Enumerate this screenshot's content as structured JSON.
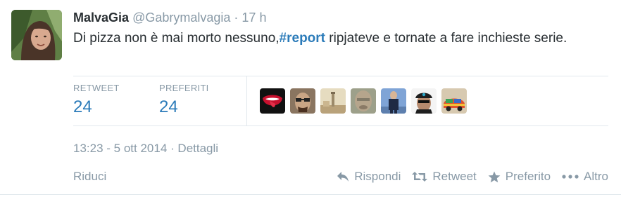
{
  "tweet": {
    "fullname": "MalvaGia",
    "username": "@Gabrymalvagia",
    "separator": "·",
    "time": "17 h",
    "text_before": "Di pizza non è mai morto nessuno,",
    "hashtag": "#report",
    "text_after": " ripjateve e tornate a fare inchieste serie."
  },
  "stats": [
    {
      "label": "RETWEET",
      "value": "24"
    },
    {
      "label": "PREFERITI",
      "value": "24"
    }
  ],
  "favoriters": [
    {
      "name": "rolling-stones-lips",
      "color": "#c8102e"
    },
    {
      "name": "man-with-glasses",
      "color": "#7a5a40"
    },
    {
      "name": "tower-landscape",
      "color": "#cdb98c"
    },
    {
      "name": "man-face-blurred",
      "color": "#8a8f7a"
    },
    {
      "name": "man-on-street",
      "color": "#6a8fc4"
    },
    {
      "name": "man-with-cap",
      "color": "#2d2d2d"
    },
    {
      "name": "colorful-car",
      "color": "#d9a040"
    }
  ],
  "datetime": {
    "timestamp": "13:23 - 5 ott 2014",
    "separator": "·",
    "details_link": "Dettagli"
  },
  "collapse_label": "Riduci",
  "actions": {
    "reply": "Rispondi",
    "retweet": "Retweet",
    "favorite": "Preferito",
    "more": "Altro"
  },
  "colors": {
    "link": "#2b7bb9",
    "muted": "#8899a6",
    "text": "#292f33",
    "border": "#e1e8ed"
  }
}
